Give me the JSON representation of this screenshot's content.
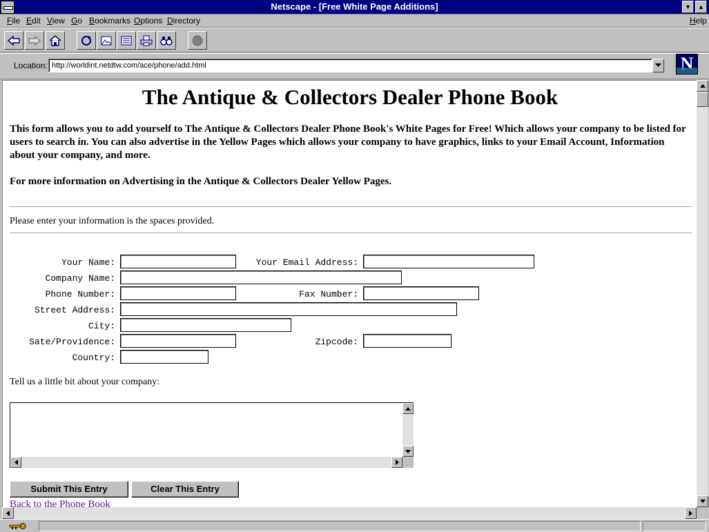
{
  "window": {
    "title": "Netscape - [Free White Page Additions]"
  },
  "menu": {
    "items": [
      "File",
      "Edit",
      "View",
      "Go",
      "Bookmarks",
      "Options",
      "Directory"
    ],
    "help": "Help"
  },
  "toolbar": {
    "buttons": [
      "back",
      "forward",
      "home",
      "reload",
      "images",
      "open",
      "print",
      "find",
      "stop"
    ]
  },
  "location": {
    "label": "Location:",
    "url": "http://worldint.netdtw.com/ace/phone/add.html"
  },
  "page": {
    "title": "The Antique & Collectors Dealer Phone Book",
    "intro": "This form allows you to add yourself to The Antique & Collectors Dealer Phone Book's White Pages for Free! Which allows your company to be listed for users to search in. You can also advertise in the Yellow Pages which allows your company to have graphics, links to your Email Account, Information about your company, and more.",
    "more_info": "For more information on Advertising in the Antique & Collectors Dealer Yellow Pages.",
    "instructions": "Please enter your information is the spaces provided.",
    "form": {
      "name_label": "Your Name:",
      "email_label": "Your Email Address:",
      "company_label": "Company Name:",
      "phone_label": "Phone Number:",
      "fax_label": "Fax Number:",
      "street_label": "Street Address:",
      "city_label": "City:",
      "state_label": "Sate/Providence:",
      "zip_label": "Zipcode:",
      "country_label": "Country:",
      "name_value": "",
      "email_value": "",
      "company_value": "",
      "phone_value": "",
      "fax_value": "",
      "street_value": "",
      "city_value": "",
      "state_value": "",
      "zip_value": "",
      "country_value": ""
    },
    "about_label": "Tell us a little bit about your company:",
    "about_value": "",
    "submit_label": "Submit This Entry",
    "clear_label": "Clear This Entry",
    "back_link": "Back to the Phone Book"
  },
  "colors": {
    "titlebar": "#000080",
    "chrome": "#c0c0c0",
    "visited_link": "#551a8b"
  }
}
